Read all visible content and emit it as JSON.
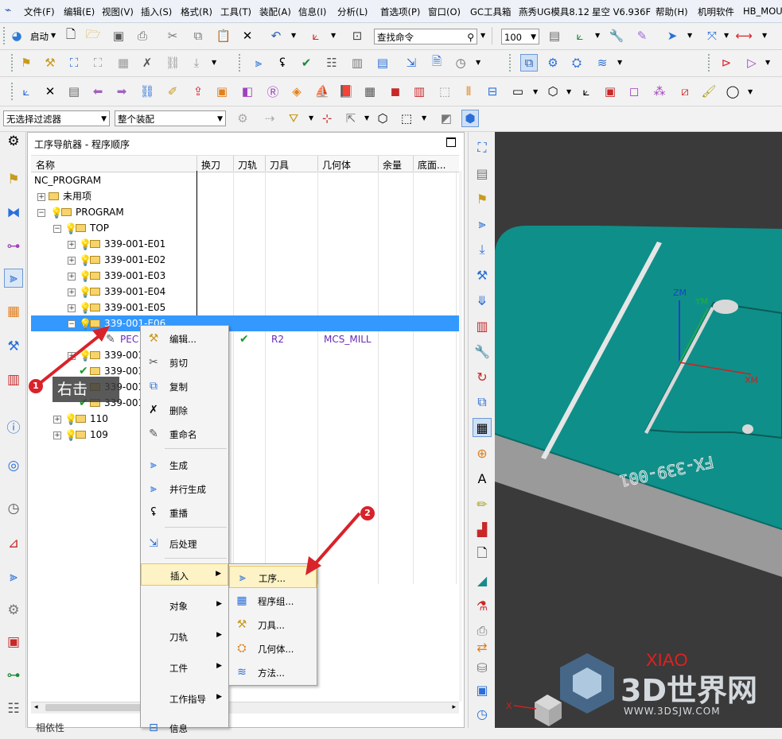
{
  "menubar": {
    "items": [
      "文件(F)",
      "编辑(E)",
      "视图(V)",
      "插入(S)",
      "格式(R)",
      "工具(T)",
      "装配(A)",
      "信息(I)",
      "分析(L)",
      "首选项(P)",
      "窗口(O)",
      "GC工具箱",
      "燕秀UG模具8.12",
      "星空 V6.936F",
      "帮助(H)",
      "机明软件",
      "HB_MOU"
    ]
  },
  "toolbar": {
    "start_label": "启动",
    "search_command_placeholder": "查找命令",
    "zoom_value": "100",
    "filter_value": "无选择过滤器",
    "assembly_value": "整个装配"
  },
  "navigator": {
    "title": "工序导航器 - 程序顺序",
    "columns": [
      "名称",
      "换刀",
      "刀轨",
      "刀具",
      "几何体",
      "余量",
      "底面..."
    ],
    "rows": [
      {
        "name": "NC_PROGRAM",
        "tool": "",
        "geom": ""
      },
      {
        "name": "未用项",
        "tool": "",
        "geom": ""
      },
      {
        "name": "PROGRAM",
        "tool": "",
        "geom": ""
      },
      {
        "name": "TOP",
        "tool": "",
        "geom": ""
      },
      {
        "name": "339-001-E01",
        "tool": "",
        "geom": ""
      },
      {
        "name": "339-001-E02",
        "tool": "",
        "geom": ""
      },
      {
        "name": "339-001-E03",
        "tool": "",
        "geom": ""
      },
      {
        "name": "339-001-E04",
        "tool": "",
        "geom": ""
      },
      {
        "name": "339-001-E05",
        "tool": "",
        "geom": ""
      },
      {
        "name": "339-001-E06",
        "tool": "",
        "geom": ""
      },
      {
        "name": "PEC",
        "tool": "R2",
        "geom": "MCS_MILL"
      },
      {
        "name": "339-001",
        "tool": "",
        "geom": ""
      },
      {
        "name": "339-001",
        "tool": "",
        "geom": ""
      },
      {
        "name": "339-001",
        "tool": "",
        "geom": ""
      },
      {
        "name": "339-001",
        "tool": "",
        "geom": ""
      },
      {
        "name": "110",
        "tool": "",
        "geom": ""
      },
      {
        "name": "109",
        "tool": "",
        "geom": ""
      }
    ],
    "bottom_label": "相依性"
  },
  "context_menu": {
    "edit": "编辑...",
    "cut": "剪切",
    "copy": "复制",
    "delete": "删除",
    "rename": "重命名",
    "generate": "生成",
    "parallel_generate": "并行生成",
    "replay": "重播",
    "postprocess": "后处理",
    "insert": "插入",
    "object": "对象",
    "toolpath": "刀轨",
    "workpiece": "工件",
    "work_instructions": "工作指导",
    "info": "信息"
  },
  "submenu": {
    "operation": "工序...",
    "program_group": "程序组...",
    "tool": "刀具...",
    "geometry": "几何体...",
    "method": "方法..."
  },
  "viewport": {
    "engraving": "FX-339-001",
    "axis_zm": "ZM",
    "axis_ym": "YM",
    "axis_xm": "XM",
    "triad_x": "X"
  },
  "annotations": {
    "badge1": "1",
    "badge2": "2",
    "right_click_label": "右击"
  },
  "watermark": {
    "tag": "XIAO",
    "brand": "3D世界网",
    "url": "WWW.3DSJW.COM"
  },
  "colors": {
    "selection": "#3399ff",
    "part_top": "#0f8f89",
    "part_side": "#9a9a9a",
    "annotation": "#d8232a",
    "menu_highlight": "#fdf3c6"
  }
}
